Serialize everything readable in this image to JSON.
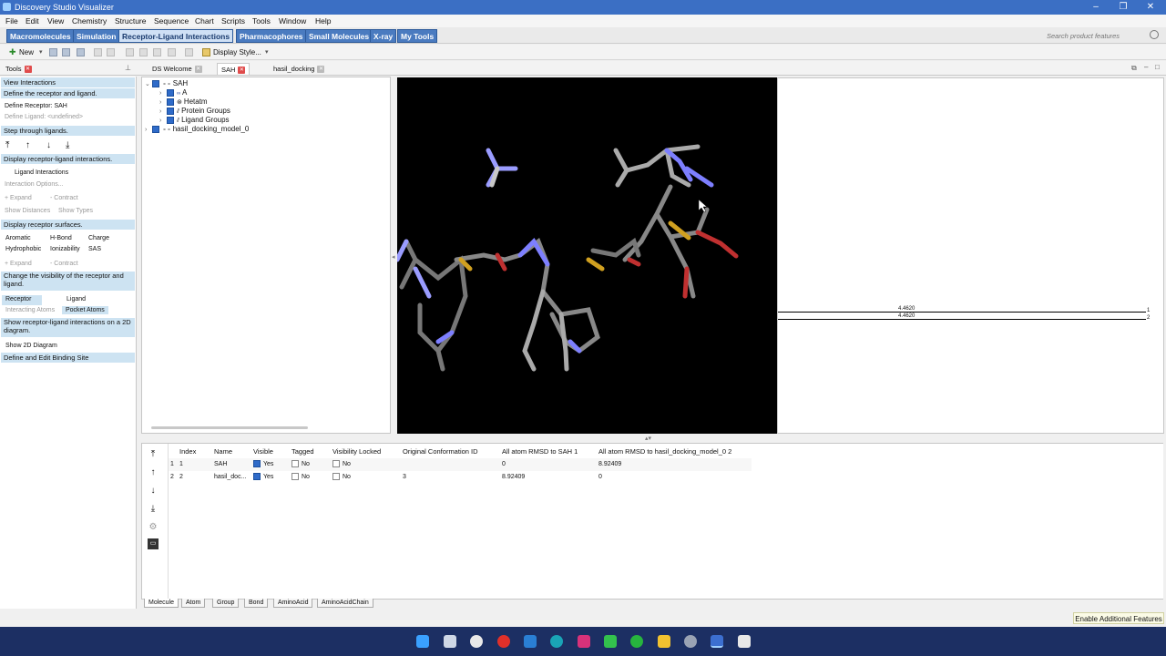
{
  "window": {
    "title": "Discovery Studio Visualizer",
    "controls": [
      "–",
      "❐",
      "✕"
    ]
  },
  "menu": [
    "File",
    "Edit",
    "View",
    "Chemistry",
    "Structure",
    "Sequence",
    "Chart",
    "Scripts",
    "Tools",
    "Window",
    "Help"
  ],
  "ribbon": {
    "tabs": [
      "Macromolecules",
      "Simulation",
      "Receptor-Ligand Interactions",
      "Pharmacophores",
      "Small Molecules",
      "X-ray",
      "My Tools"
    ],
    "active": "Receptor-Ligand Interactions",
    "search_placeholder": "Search product features"
  },
  "toolbar": {
    "new_label": "New",
    "display_style_label": "Display Style..."
  },
  "doc_tabs": [
    {
      "label": "DS Welcome"
    },
    {
      "label": "SAH"
    },
    {
      "label": "hasil_docking"
    }
  ],
  "tools": {
    "header": "Tools",
    "view_interactions": "View Interactions",
    "define_rl": "Define the receptor and ligand.",
    "define_receptor": "Define Receptor: SAH",
    "define_ligand": "Define Ligand: <undefined>",
    "step_through": "Step through ligands.",
    "display_interactions": "Display receptor-ligand interactions.",
    "ligand_interactions": "Ligand Interactions",
    "interaction_options": "Interaction Options...",
    "expand": "+ Expand",
    "contract": "- Contract",
    "show_distances": "Show Distances",
    "show_types": "Show Types",
    "display_surfaces": "Display receptor surfaces.",
    "aromatic": "Aromatic",
    "hbond": "H-Bond",
    "charge": "Charge",
    "hydrophobic": "Hydrophobic",
    "ionizability": "Ionizability",
    "sas": "SAS",
    "change_visibility": "Change the visibility of the receptor and ligand.",
    "receptor": "Receptor",
    "ligand": "Ligand",
    "interacting_atoms": "Interacting Atoms",
    "pocket_atoms": "Pocket Atoms",
    "show_2d_desc": "Show receptor-ligand interactions on a 2D diagram.",
    "show_2d": "Show 2D Diagram",
    "binding_site": "Define and Edit Binding Site"
  },
  "tree": [
    {
      "label": "SAH",
      "level": 0
    },
    {
      "label": "A",
      "level": 1
    },
    {
      "label": "Hetatm",
      "level": 1
    },
    {
      "label": "Protein Groups",
      "level": 1
    },
    {
      "label": "Ligand Groups",
      "level": 1
    },
    {
      "label": "hasil_docking_model_0",
      "level": 0
    }
  ],
  "graph": {
    "labels": [
      "4.4620",
      "4.4620"
    ],
    "row_markers": [
      "1",
      "2"
    ]
  },
  "table": {
    "headers": [
      "Index",
      "Name",
      "Visible",
      "Tagged",
      "Visibility Locked",
      "Original Conformation ID",
      "All atom RMSD to SAH 1",
      "All atom RMSD to hasil_docking_model_0 2"
    ],
    "rows": [
      {
        "row": "1",
        "index": "1",
        "name": "SAH",
        "visible": "Yes",
        "tagged": "No",
        "locked": "No",
        "orig": "",
        "rmsd1": "0",
        "rmsd2": "8.92409"
      },
      {
        "row": "2",
        "index": "2",
        "name": "hasil_doc...",
        "visible": "Yes",
        "tagged": "No",
        "locked": "No",
        "orig": "3",
        "rmsd1": "8.92409",
        "rmsd2": "0"
      }
    ]
  },
  "bottom_tabs": [
    "Molecule",
    "Atom",
    "Group",
    "Bond",
    "AminoAcid",
    "AminoAcidChain"
  ],
  "status": {
    "enable_features": "Enable Additional Features"
  },
  "colors": {
    "title": "#3b6fc4",
    "ribbon_tab": "#4a7bc0",
    "section": "#cde3f2",
    "taskbar": "#1c2f63"
  }
}
